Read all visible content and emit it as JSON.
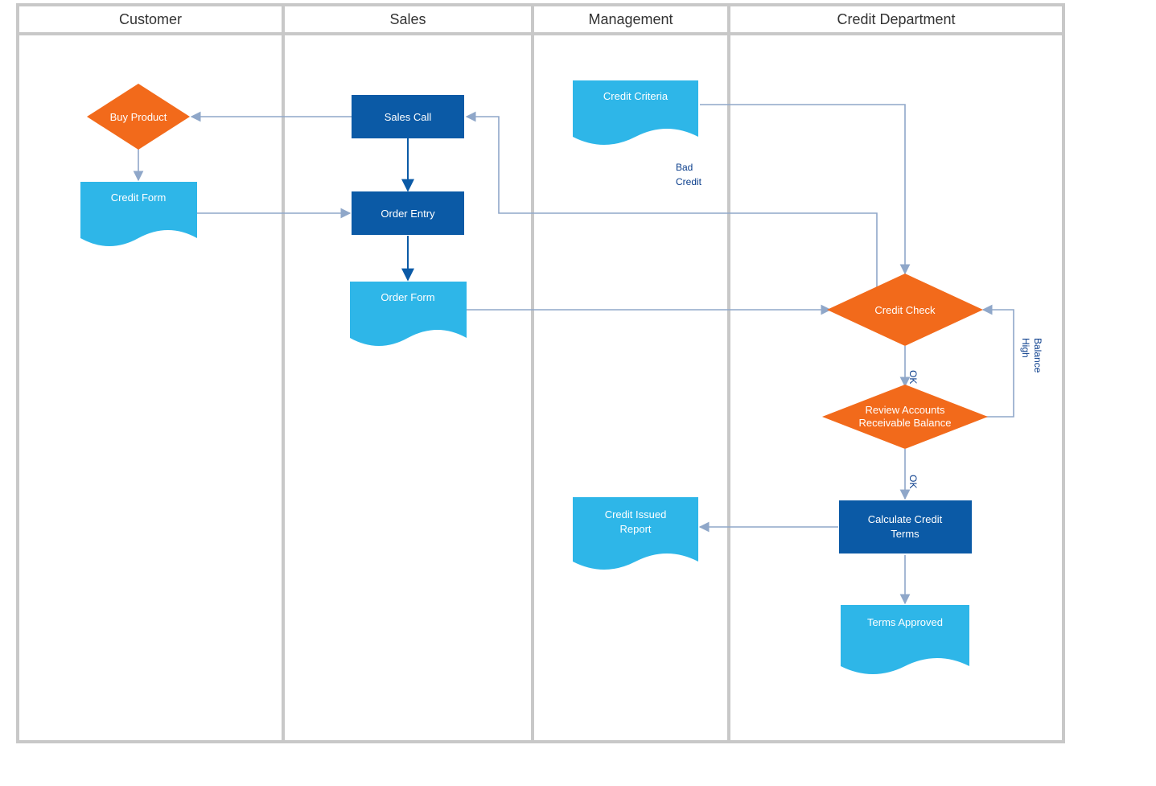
{
  "lanes": {
    "customer": "Customer",
    "sales": "Sales",
    "management": "Management",
    "credit": "Credit Department"
  },
  "nodes": {
    "buy_product": "Buy Product",
    "credit_form": "Credit Form",
    "sales_call": "Sales Call",
    "order_entry": "Order Entry",
    "order_form": "Order Form",
    "credit_criteria": "Credit Criteria",
    "credit_issued_report": "Credit Issued",
    "credit_issued_report2": "Report",
    "credit_check": "Credit Check",
    "review_ar_1": "Review Accounts",
    "review_ar_2": "Receivable Balance",
    "calc_terms_1": "Calculate Credit",
    "calc_terms_2": "Terms",
    "terms_approved": "Terms Approved"
  },
  "edge_labels": {
    "bad_credit_1": "Bad",
    "bad_credit_2": "Credit",
    "ok1": "OK",
    "ok2": "OK",
    "high_1": "High",
    "high_2": "Balance"
  },
  "colors": {
    "orange": "#F26A1B",
    "blue_dark": "#0B5AA6",
    "blue_light": "#2EB6E8",
    "lane_gray": "#C8C8C8",
    "arrow": "#8FA7C9"
  }
}
